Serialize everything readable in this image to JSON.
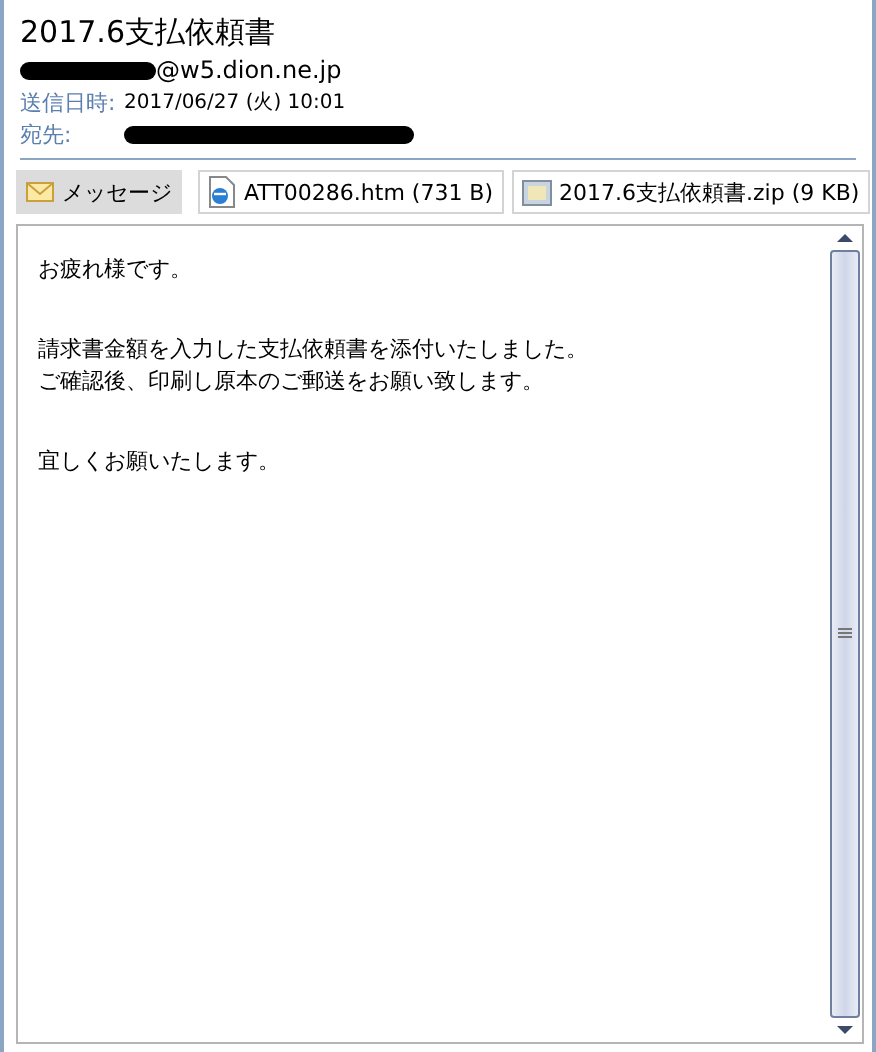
{
  "subject": "2017.6支払依頼書",
  "sender": "@w5.dion.ne.jp",
  "fields": [
    {
      "label": "送信日時:",
      "value": "2017/06/27 (火) 10:01"
    },
    {
      "label": "宛先:"
    }
  ],
  "attachments": [
    {
      "kind": "message",
      "label": "メッセージ",
      "selected": true
    },
    {
      "kind": "htm",
      "label": "ATT00286.htm (731 B)",
      "selected": false
    },
    {
      "kind": "zip",
      "label": "2017.6支払依頼書.zip (9 KB)",
      "selected": false
    }
  ],
  "body": [
    [
      "お疲れ様です。"
    ],
    [
      "請求書金額を入力した支払依頼書を添付いたしました。",
      "ご確認後、印刷し原本のご郵送をお願い致します。"
    ],
    [
      "宜しくお願いたします。"
    ]
  ]
}
